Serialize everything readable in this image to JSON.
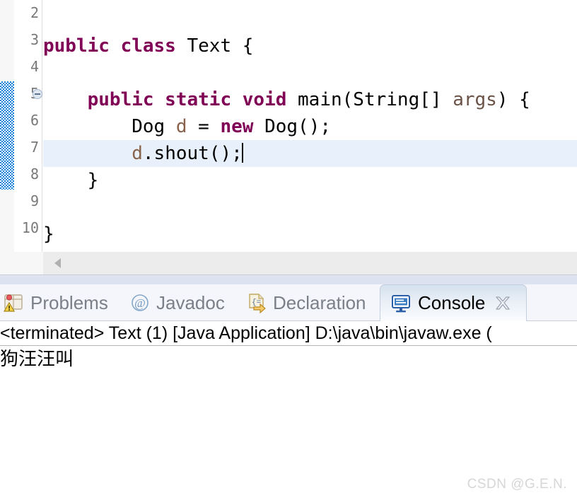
{
  "editor": {
    "lines": [
      {
        "number": "2",
        "segments": []
      },
      {
        "number": "3",
        "segments": [
          {
            "text": "public class ",
            "style": "kw"
          },
          {
            "text": "Text {",
            "style": "plain"
          }
        ]
      },
      {
        "number": "4",
        "segments": []
      },
      {
        "number": "5",
        "segments": [
          {
            "text": "    public static void ",
            "style": "kw"
          },
          {
            "text": "main(String[] ",
            "style": "plain"
          },
          {
            "text": "args",
            "style": "param"
          },
          {
            "text": ") {",
            "style": "plain"
          }
        ]
      },
      {
        "number": "6",
        "segments": [
          {
            "text": "        Dog ",
            "style": "plain"
          },
          {
            "text": "d",
            "style": "lvar"
          },
          {
            "text": " = ",
            "style": "plain"
          },
          {
            "text": "new ",
            "style": "kw"
          },
          {
            "text": "Dog();",
            "style": "plain"
          }
        ]
      },
      {
        "number": "7",
        "segments": [
          {
            "text": "        ",
            "style": "plain"
          },
          {
            "text": "d",
            "style": "lvar"
          },
          {
            "text": ".shout();",
            "style": "plain"
          }
        ]
      },
      {
        "number": "8",
        "segments": [
          {
            "text": "    }",
            "style": "plain"
          }
        ]
      },
      {
        "number": "9",
        "segments": []
      },
      {
        "number": "10",
        "segments": [
          {
            "text": "}",
            "style": "plain"
          }
        ]
      }
    ],
    "line_text": {
      "l3": "public class Text {",
      "l5": "    public static void main(String[] args) {",
      "l6": "        Dog d = new Dog();",
      "l7": "        d.shout();",
      "l8": "    }",
      "l10": "}"
    },
    "numbers": {
      "n2": "2",
      "n3": "3",
      "n4": "4",
      "n5": "5",
      "n6": "6",
      "n7": "7",
      "n8": "8",
      "n9": "9",
      "n10": "10"
    },
    "highlighted_line": "7",
    "fold_widget_line": "5",
    "colors": {
      "keyword": "#7f0055",
      "plain": "#000000",
      "parameter": "#6a5247",
      "local_variable": "#88624a",
      "line_number": "#787878",
      "current_line_highlight": "#e8f1fb",
      "fold_range_indicator": "#1680d4"
    }
  },
  "bottom_panel": {
    "tabs": [
      {
        "label": "Problems",
        "icon": "problems-icon",
        "active": false
      },
      {
        "label": "Javadoc",
        "icon": "javadoc-at-icon",
        "active": false
      },
      {
        "label": "Declaration",
        "icon": "declaration-icon",
        "active": false
      },
      {
        "label": "Console",
        "icon": "console-icon",
        "active": true,
        "close_icon": "close-icon"
      }
    ],
    "tab_labels": {
      "problems": "Problems",
      "javadoc": "Javadoc",
      "declaration": "Declaration",
      "console": "Console"
    },
    "console": {
      "header": "<terminated> Text (1) [Java Application] D:\\java\\bin\\javaw.exe (",
      "output": "狗汪汪叫"
    }
  },
  "watermark": {
    "text": "CSDN @G.E.N."
  }
}
